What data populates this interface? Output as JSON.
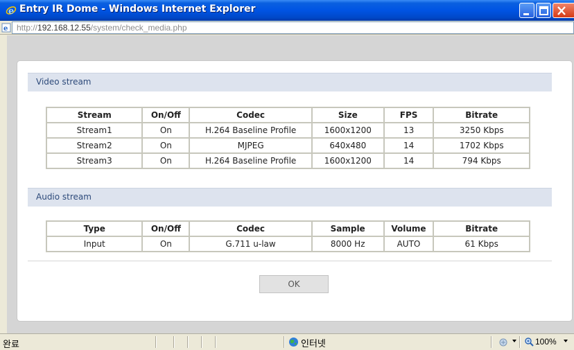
{
  "window": {
    "title": "Entry IR Dome - Windows Internet Explorer"
  },
  "address": {
    "prefix": "http://",
    "host": "192.168.12.55",
    "path": "/system/check_media.php"
  },
  "video": {
    "section_title": "Video stream",
    "headers": [
      "Stream",
      "On/Off",
      "Codec",
      "Size",
      "FPS",
      "Bitrate"
    ],
    "rows": [
      [
        "Stream1",
        "On",
        "H.264 Baseline Profile",
        "1600x1200",
        "13",
        "3250 Kbps"
      ],
      [
        "Stream2",
        "On",
        "MJPEG",
        "640x480",
        "14",
        "1702 Kbps"
      ],
      [
        "Stream3",
        "On",
        "H.264 Baseline Profile",
        "1600x1200",
        "14",
        "794 Kbps"
      ]
    ]
  },
  "audio": {
    "section_title": "Audio stream",
    "headers": [
      "Type",
      "On/Off",
      "Codec",
      "Sample",
      "Volume",
      "Bitrate"
    ],
    "rows": [
      [
        "Input",
        "On",
        "G.711 u-law",
        "8000 Hz",
        "AUTO",
        "61 Kbps"
      ]
    ]
  },
  "ok_label": "OK",
  "status": {
    "text": "완료",
    "zone": "인터넷",
    "zoom": "100%"
  },
  "icons": {
    "title": "ie-logo-icon",
    "address": "ie-page-icon",
    "zone": "globe-icon",
    "protect": "protected-mode-icon",
    "zoom": "zoom-icon"
  },
  "colors": {
    "titlebar": "#0054e3",
    "section_head": "#dde3ee",
    "section_text": "#2d4a7a"
  }
}
